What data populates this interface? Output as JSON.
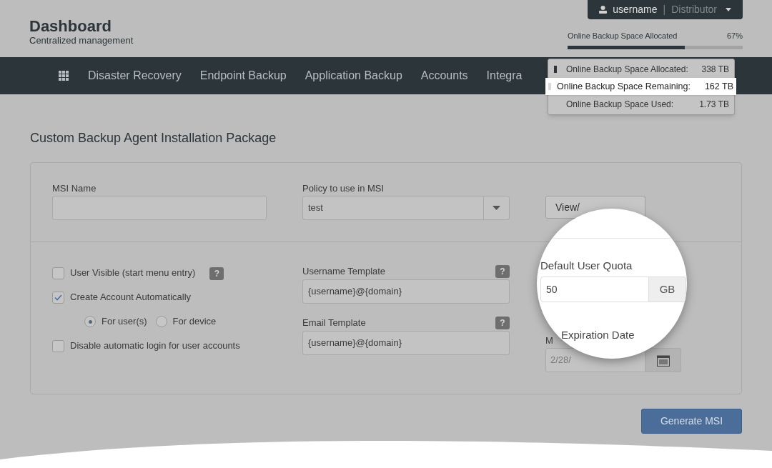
{
  "header": {
    "title": "Dashboard",
    "subtitle": "Centralized management"
  },
  "user_menu": {
    "username": "username",
    "separator": "|",
    "role": "Distributor"
  },
  "quota": {
    "label": "Online Backup Space Allocated",
    "percent": "67%",
    "level": 0.67
  },
  "quota_popover": {
    "rows": [
      {
        "label": "Online Backup Space Allocated:",
        "value": "338 TB",
        "selected": false,
        "color": "#2c3539"
      },
      {
        "label": "Online Backup Space Remaining:",
        "value": "162 TB",
        "selected": true,
        "color": "#d9d9d9"
      },
      {
        "label": "Online Backup Space Used:",
        "value": "1.73 TB",
        "selected": false
      }
    ]
  },
  "nav": {
    "items": [
      "Disaster Recovery",
      "Endpoint Backup",
      "Application Backup",
      "Accounts",
      "Integra"
    ]
  },
  "section_title": "Custom Backup Agent Installation Package",
  "msi_name": {
    "label": "MSI Name"
  },
  "policy": {
    "label": "Policy to use in MSI",
    "value": "test"
  },
  "policies_button": "View/",
  "options": [
    {
      "kind": "checkbox",
      "label": "User Visible (start menu entry)",
      "checked": false,
      "help": "?"
    },
    {
      "kind": "checkbox",
      "label": "Create Account Automatically",
      "checked": true
    },
    {
      "kind": "radios",
      "options": [
        {
          "label": "For user(s)",
          "selected": true
        },
        {
          "label": "For device",
          "selected": false
        }
      ]
    },
    {
      "kind": "checkbox",
      "label": "Disable automatic login for user accounts",
      "checked": false
    }
  ],
  "username_template": {
    "label": "Username Template",
    "value": "{username}@{domain}",
    "help": "?"
  },
  "email_template": {
    "label": "Email Template",
    "value": "{username}@{domain}",
    "help": "?"
  },
  "expiration": {
    "label_fragment": "M",
    "value": "2/28/"
  },
  "magnifier": {
    "quota_label": "Default User Quota",
    "quota_value": "50",
    "quota_unit": "GB",
    "expiration_label": "Expiration Date"
  },
  "generate_button": "Generate MSI"
}
